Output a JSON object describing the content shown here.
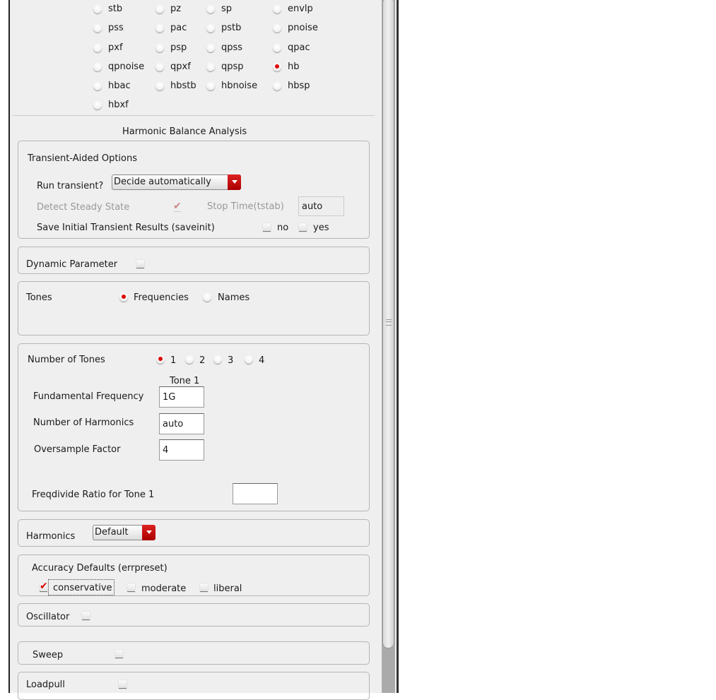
{
  "analysis_types": [
    [
      "stb",
      "pz",
      "sp",
      "envlp"
    ],
    [
      "pss",
      "pac",
      "pstb",
      "pnoise"
    ],
    [
      "pxf",
      "psp",
      "qpss",
      "qpac"
    ],
    [
      "qpnoise",
      "qpxf",
      "qpsp",
      "hb"
    ],
    [
      "hbac",
      "hbstb",
      "hbnoise",
      "hbsp"
    ],
    [
      "hbxf"
    ]
  ],
  "selected_analysis": "hb",
  "section_title": "Harmonic Balance Analysis",
  "transient": {
    "title": "Transient-Aided Options",
    "run_label": "Run transient?",
    "run_value": "Decide automatically",
    "detect_label": "Detect Steady State",
    "detect_checked": true,
    "stop_label": "Stop Time(tstab)",
    "stop_value": "auto",
    "saveinit_label": "Save Initial Transient Results (saveinit)",
    "no_label": "no",
    "yes_label": "yes"
  },
  "dynamic_label": "Dynamic Parameter",
  "tones": {
    "label": "Tones",
    "opt_freq": "Frequencies",
    "opt_names": "Names",
    "selected": "Frequencies"
  },
  "num_tones": {
    "label": "Number of Tones",
    "options": [
      "1",
      "2",
      "3",
      "4"
    ],
    "selected": "1",
    "column_header": "Tone 1",
    "fund_label": "Fundamental Frequency",
    "fund_value": "1G",
    "harm_label": "Number of Harmonics",
    "harm_value": "auto",
    "over_label": "Oversample Factor",
    "over_value": "4",
    "freqdiv_label": "Freqdivide Ratio for Tone 1",
    "freqdiv_value": ""
  },
  "harmonics": {
    "label": "Harmonics",
    "value": "Default"
  },
  "accuracy": {
    "title": "Accuracy Defaults (errpreset)",
    "conservative": "conservative",
    "moderate": "moderate",
    "liberal": "liberal",
    "selected": "conservative"
  },
  "oscillator_label": "Oscillator",
  "sweep_label": "Sweep",
  "loadpull_label": "Loadpull"
}
